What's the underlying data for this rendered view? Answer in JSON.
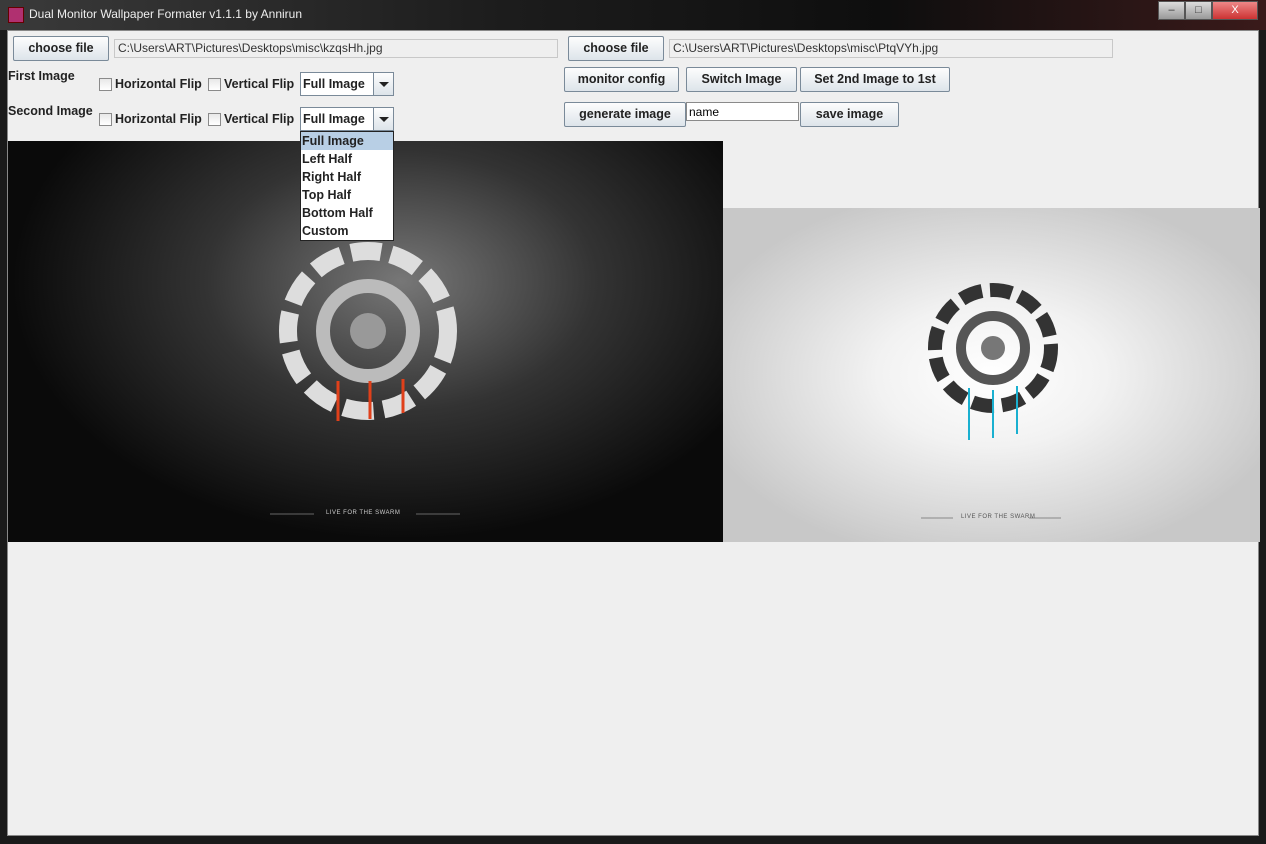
{
  "window": {
    "title": "Dual Monitor Wallpaper Formater v1.1.1 by Annirun",
    "minimize": "–",
    "maximize": "□",
    "close": "X"
  },
  "first": {
    "choose_label": "choose file",
    "path": "C:\\Users\\ART\\Pictures\\Desktops\\misc\\kzqsHh.jpg",
    "section_label": "First Image",
    "hflip": "Horizontal Flip",
    "vflip": "Vertical Flip",
    "mode": "Full Image"
  },
  "second": {
    "choose_label": "choose file",
    "path": "C:\\Users\\ART\\Pictures\\Desktops\\misc\\PtqVYh.jpg",
    "section_label": "Second Image",
    "hflip": "Horizontal Flip",
    "vflip": "Vertical Flip",
    "mode": "Full Image"
  },
  "dropdown": {
    "options": [
      "Full Image",
      "Left Half",
      "Right Half",
      "Top Half",
      "Bottom Half",
      "Custom"
    ],
    "selected": "Full Image"
  },
  "actions": {
    "monitor_config": "monitor config",
    "switch_image": "Switch Image",
    "set_2nd_to_1st": "Set 2nd Image to 1st",
    "generate_image": "generate image",
    "name_value": "name",
    "save_image": "save image"
  },
  "preview": {
    "caption": "LIVE FOR THE SWARM",
    "accent_first": "#e0401a",
    "accent_second": "#1ab0d0"
  }
}
